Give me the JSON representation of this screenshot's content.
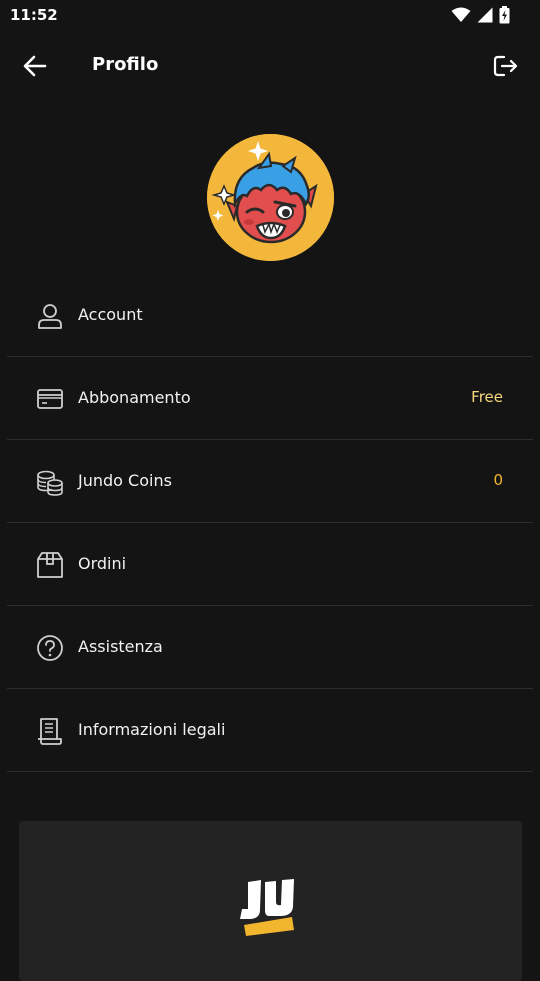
{
  "status_bar": {
    "time": "11:52",
    "icons": [
      "wifi-icon",
      "signal-icon",
      "battery-charging-icon"
    ]
  },
  "header": {
    "title": "Profilo",
    "back_icon": "arrow-left-icon",
    "logout_icon": "logout-icon"
  },
  "menu": {
    "items": [
      {
        "label": "Account",
        "icon": "person-icon",
        "value": ""
      },
      {
        "label": "Abbonamento",
        "icon": "credit-card-icon",
        "value": "Free"
      },
      {
        "label": "Jundo Coins",
        "icon": "coins-icon",
        "value": "0"
      },
      {
        "label": "Ordini",
        "icon": "box-icon",
        "value": ""
      },
      {
        "label": "Assistenza",
        "icon": "help-circle-icon",
        "value": ""
      },
      {
        "label": "Informazioni legali",
        "icon": "document-icon",
        "value": ""
      }
    ]
  },
  "colors": {
    "background": "#141414",
    "card": "#232323",
    "divider": "#2e2e2e",
    "accent_free": "#f6d77e",
    "accent_coins": "#f1b52e",
    "avatar_bg": "#f3b73b"
  }
}
